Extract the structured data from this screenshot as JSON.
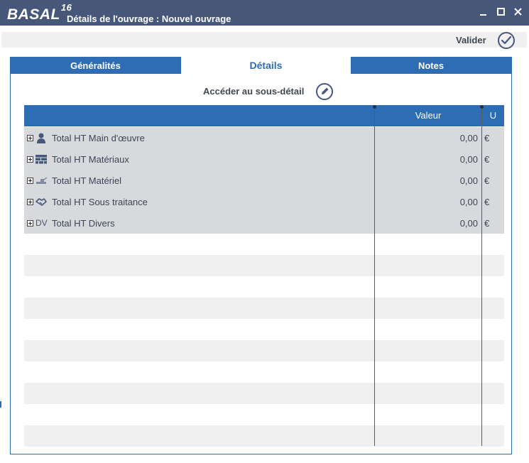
{
  "window": {
    "logo": "BASAL",
    "logo_version": "16",
    "title": "Détails de l'ouvrage : Nouvel ouvrage"
  },
  "toolbar": {
    "validate_label": "Valider"
  },
  "tabs": [
    {
      "label": "Généralités",
      "active": false
    },
    {
      "label": "Détails",
      "active": true
    },
    {
      "label": "Notes",
      "active": false
    }
  ],
  "subdetail": {
    "label": "Accéder au sous-détail"
  },
  "grid": {
    "columns": {
      "value": "Valeur",
      "unit": "U"
    },
    "rows": [
      {
        "icon": "person-icon",
        "label": "Total HT Main d'œuvre",
        "value": "0,00",
        "unit": "€"
      },
      {
        "icon": "bricks-icon",
        "label": "Total HT Matériaux",
        "value": "0,00",
        "unit": "€"
      },
      {
        "icon": "machinery-icon",
        "label": "Total HT Matériel",
        "value": "0,00",
        "unit": "€"
      },
      {
        "icon": "handshake-icon",
        "label": "Total HT Sous traitance",
        "value": "0,00",
        "unit": "€"
      },
      {
        "icon": "dv-icon",
        "icon_text": "DV",
        "label": "Total HT Divers",
        "value": "0,00",
        "unit": "€"
      }
    ]
  },
  "colors": {
    "titlebar": "#47577a",
    "accent": "#2e6db4",
    "row_data": "#d8d9dc",
    "row_alt": "#f0f0f0"
  }
}
